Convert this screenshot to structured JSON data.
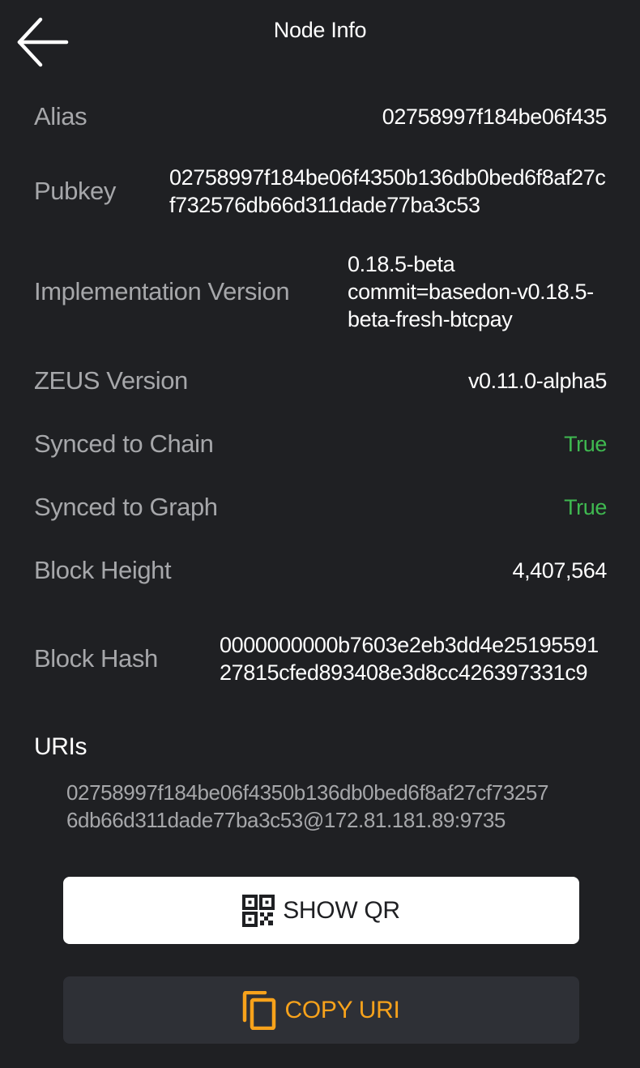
{
  "header": {
    "title": "Node Info",
    "back_icon": "arrow-left-icon"
  },
  "info": {
    "alias": {
      "label": "Alias",
      "value": "02758997f184be06f435"
    },
    "pubkey": {
      "label": "Pubkey",
      "value": "02758997f184be06f4350b136db0bed6f8af27cf732576db66d311dade77ba3c53"
    },
    "implementation_version": {
      "label": "Implementation Version",
      "value_line1": "0.18.5-beta",
      "value_line2": "commit=basedon-v0.18.5-",
      "value_line3": "beta-fresh-btcpay"
    },
    "zeus_version": {
      "label": "ZEUS Version",
      "value": "v0.11.0-alpha5"
    },
    "synced_to_chain": {
      "label": "Synced to Chain",
      "value": "True"
    },
    "synced_to_graph": {
      "label": "Synced to Graph",
      "value": "True"
    },
    "block_height": {
      "label": "Block Height",
      "value": "4,407,564"
    },
    "block_hash": {
      "label": "Block Hash",
      "value": "0000000000b7603e2eb3dd4e2519559127815cfed893408e3d8cc426397331c9"
    }
  },
  "uris": {
    "title": "URIs",
    "value": "02758997f184be06f4350b136db0bed6f8af27cf732576db66d311dade77ba3c53@172.81.181.89:9735"
  },
  "buttons": {
    "show_qr": {
      "label": "SHOW QR",
      "icon": "qr-code-icon"
    },
    "copy_uri": {
      "label": "COPY URI",
      "icon": "copy-icon"
    }
  },
  "colors": {
    "background": "#1f2023",
    "label": "#a6a7aa",
    "status_true": "#3fb950",
    "accent": "#f7a21b",
    "copy_button_bg": "#2e3036"
  }
}
